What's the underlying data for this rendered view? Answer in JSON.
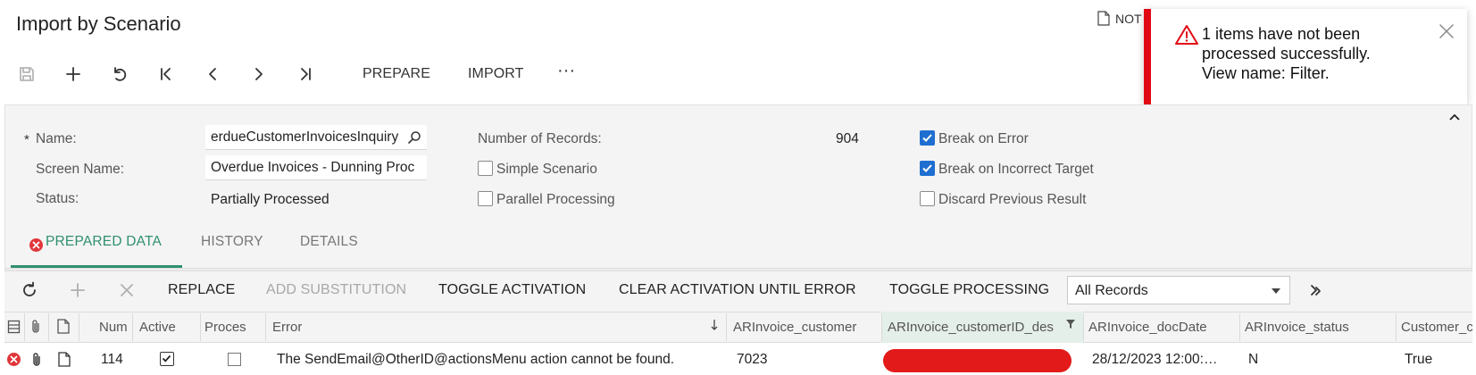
{
  "page": {
    "title": "Import by Scenario",
    "notes_label": "NOT"
  },
  "toolbar": {
    "prepare_label": "PREPARE",
    "import_label": "IMPORT",
    "more_label": "···"
  },
  "toast": {
    "message_line1": "1 items have not been",
    "message_line2": "processed successfully.",
    "message_line3": "View name: Filter."
  },
  "form": {
    "name_label": "Name:",
    "name_value": "erdueCustomerInvoicesInquiry",
    "screen_name_label": "Screen Name:",
    "screen_name_value": "Overdue Invoices - Dunning Proc",
    "status_label": "Status:",
    "status_value": "Partially Processed",
    "records_label": "Number of Records:",
    "records_value": "904",
    "simple_scenario_label": "Simple Scenario",
    "simple_scenario_checked": false,
    "parallel_processing_label": "Parallel Processing",
    "parallel_processing_checked": false,
    "break_on_error_label": "Break on Error",
    "break_on_error_checked": true,
    "break_on_incorrect_target_label": "Break on Incorrect Target",
    "break_on_incorrect_target_checked": true,
    "discard_previous_label": "Discard Previous Result",
    "discard_previous_checked": false
  },
  "tabs": [
    {
      "label": "PREPARED DATA",
      "active": true,
      "has_error": true
    },
    {
      "label": "HISTORY",
      "active": false
    },
    {
      "label": "DETAILS",
      "active": false
    }
  ],
  "grid_toolbar": {
    "replace_label": "REPLACE",
    "add_substitution_label": "ADD SUBSTITUTION",
    "toggle_activation_label": "TOGGLE ACTIVATION",
    "clear_activation_label": "CLEAR ACTIVATION UNTIL ERROR",
    "toggle_processing_label": "TOGGLE PROCESSING",
    "filter_value": "All Records"
  },
  "grid": {
    "columns": [
      "Num",
      "Active",
      "Proces",
      "Error",
      "ARInvoice_customer",
      "ARInvoice_customerID_des",
      "ARInvoice_docDate",
      "ARInvoice_status",
      "Customer_c"
    ],
    "rows": [
      {
        "num": "114",
        "active": true,
        "processed": false,
        "error": "The SendEmail@OtherID@actionsMenu action cannot be found.",
        "customer": "7023",
        "customer_desc": "",
        "doc_date": "28/12/2023 12:00:…",
        "status": "N",
        "customer_c": "True"
      }
    ]
  },
  "colors": {
    "accent": "#2f8f6f",
    "error": "#e10a14",
    "checkbox": "#1f6fd1",
    "panel": "#f4f4f4"
  }
}
